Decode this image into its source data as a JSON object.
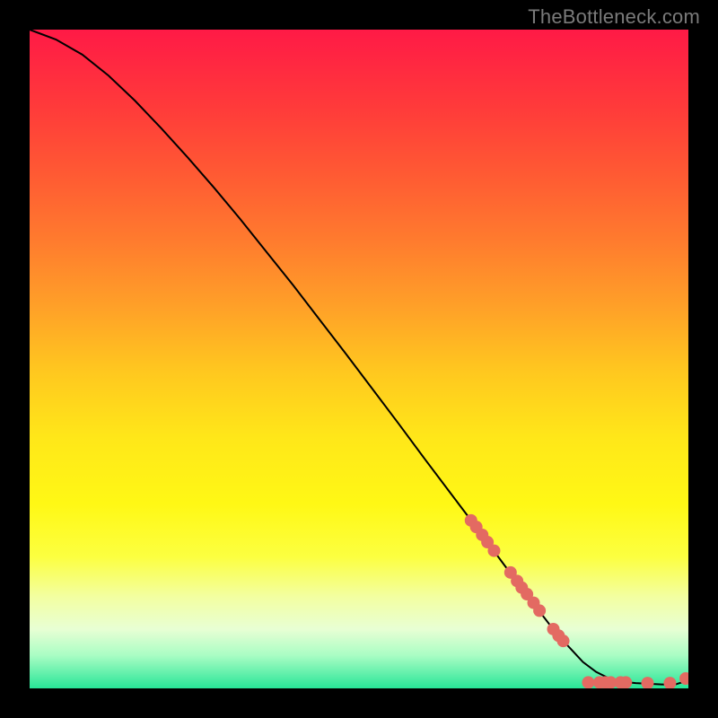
{
  "watermark": "TheBottleneck.com",
  "chart_data": {
    "type": "line",
    "title": "",
    "xlabel": "",
    "ylabel": "",
    "xlim": [
      0,
      100
    ],
    "ylim": [
      0,
      100
    ],
    "series": [
      {
        "name": "curve",
        "x": [
          0,
          4,
          8,
          12,
          16,
          20,
          24,
          28,
          32,
          36,
          40,
          44,
          48,
          52,
          56,
          60,
          64,
          68,
          72,
          76,
          80,
          84,
          86,
          88,
          90,
          92,
          94,
          96,
          98,
          100
        ],
        "y": [
          100,
          98.5,
          96.2,
          93.0,
          89.2,
          85.0,
          80.6,
          76.0,
          71.2,
          66.2,
          61.2,
          56.0,
          50.8,
          45.5,
          40.2,
          34.8,
          29.5,
          24.2,
          18.8,
          13.5,
          8.3,
          4.0,
          2.5,
          1.5,
          1.0,
          0.8,
          0.7,
          0.6,
          0.6,
          1.2
        ]
      }
    ],
    "markers": [
      {
        "x": 67.0,
        "y": 25.5
      },
      {
        "x": 67.8,
        "y": 24.5
      },
      {
        "x": 68.7,
        "y": 23.3
      },
      {
        "x": 69.5,
        "y": 22.2
      },
      {
        "x": 70.5,
        "y": 20.9
      },
      {
        "x": 73.0,
        "y": 17.6
      },
      {
        "x": 74.0,
        "y": 16.3
      },
      {
        "x": 74.7,
        "y": 15.3
      },
      {
        "x": 75.5,
        "y": 14.3
      },
      {
        "x": 76.5,
        "y": 13.0
      },
      {
        "x": 77.4,
        "y": 11.8
      },
      {
        "x": 79.5,
        "y": 9.0
      },
      {
        "x": 80.3,
        "y": 8.0
      },
      {
        "x": 81.0,
        "y": 7.2
      },
      {
        "x": 84.8,
        "y": 0.9
      },
      {
        "x": 86.5,
        "y": 0.9
      },
      {
        "x": 87.4,
        "y": 0.9
      },
      {
        "x": 88.2,
        "y": 0.9
      },
      {
        "x": 89.7,
        "y": 0.9
      },
      {
        "x": 90.5,
        "y": 0.9
      },
      {
        "x": 93.8,
        "y": 0.8
      },
      {
        "x": 97.2,
        "y": 0.8
      },
      {
        "x": 99.6,
        "y": 1.5
      }
    ],
    "marker_style": {
      "color": "#e36a62",
      "radius_px": 7
    }
  }
}
